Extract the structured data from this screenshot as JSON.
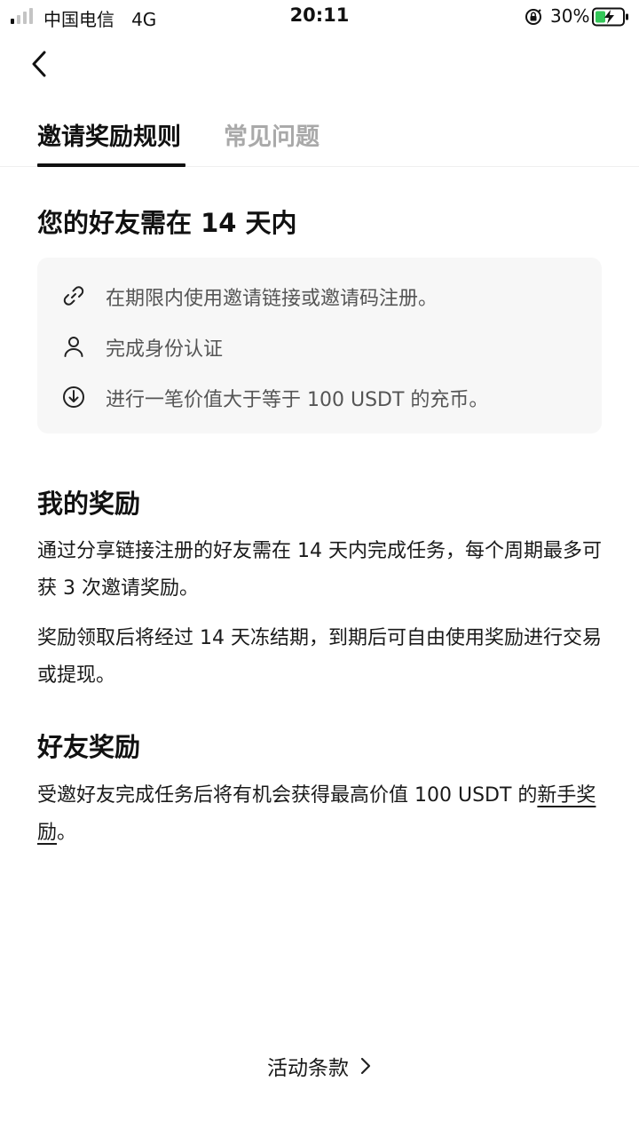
{
  "status_bar": {
    "carrier": "中国电信",
    "network": "4G",
    "time": "20:11",
    "battery": "30%"
  },
  "tabs": [
    {
      "label": "邀请奖励规则",
      "active": true
    },
    {
      "label": "常见问题",
      "active": false
    }
  ],
  "friend_task": {
    "title": "您的好友需在 14 天内",
    "steps": [
      {
        "icon": "link-icon",
        "text": "在期限内使用邀请链接或邀请码注册。"
      },
      {
        "icon": "user-icon",
        "text": "完成身份认证"
      },
      {
        "icon": "deposit-icon",
        "text": "进行一笔价值大于等于 100 USDT 的充币。"
      }
    ]
  },
  "my_reward": {
    "title": "我的奖励",
    "para1": "通过分享链接注册的好友需在 14 天内完成任务，每个周期最多可获 3 次邀请奖励。",
    "para2": "奖励领取后将经过 14 天冻结期，到期后可自由使用奖励进行交易或提现。"
  },
  "friend_reward": {
    "title": "好友奖励",
    "text": "受邀好友完成任务后将有机会获得最高价值 100 USDT 的",
    "link": "新手奖励",
    "tail": "。"
  },
  "footer": {
    "terms_label": "活动条款"
  },
  "colors": {
    "primary_text": "#111111",
    "inactive_tab": "#a9a9a9",
    "card_bg": "#f7f7f7",
    "battery_green": "#34c759"
  }
}
